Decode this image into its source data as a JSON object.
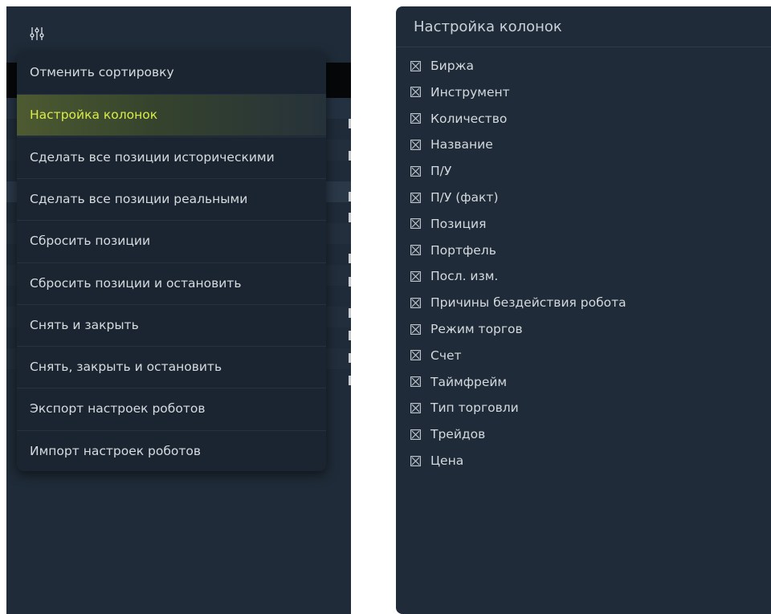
{
  "context_menu": {
    "items": [
      {
        "label": "Отменить сортировку"
      },
      {
        "label": "Настройка колонок",
        "active": true
      },
      {
        "label": "Сделать все позиции историческими"
      },
      {
        "label": "Сделать все позиции реальными"
      },
      {
        "label": "Сбросить позиции"
      },
      {
        "label": "Сбросить позиции и остановить"
      },
      {
        "label": "Снять и закрыть"
      },
      {
        "label": "Снять, закрыть и остановить"
      },
      {
        "label": "Экспорт настроек роботов"
      },
      {
        "label": "Импорт настроек роботов"
      }
    ]
  },
  "columns_panel": {
    "title": "Настройка колонок",
    "columns": [
      {
        "label": "Биржа",
        "checked": true
      },
      {
        "label": "Инструмент",
        "checked": true
      },
      {
        "label": "Количество",
        "checked": true
      },
      {
        "label": "Название",
        "checked": true
      },
      {
        "label": "П/У",
        "checked": true
      },
      {
        "label": "П/У (факт)",
        "checked": true
      },
      {
        "label": "Позиция",
        "checked": true
      },
      {
        "label": "Портфель",
        "checked": true
      },
      {
        "label": "Посл. изм.",
        "checked": true
      },
      {
        "label": "Причины бездействия робота",
        "checked": true
      },
      {
        "label": "Режим торгов",
        "checked": true
      },
      {
        "label": "Счет",
        "checked": true
      },
      {
        "label": "Таймфрейм",
        "checked": true
      },
      {
        "label": "Тип торговли",
        "checked": true
      },
      {
        "label": "Трейдов",
        "checked": true
      },
      {
        "label": "Цена",
        "checked": true
      }
    ]
  },
  "icons": {
    "toolbar": "sliders-icon",
    "checkbox": "checkbox-crossed-icon"
  },
  "colors": {
    "panel_bg": "#1f2b38",
    "menu_bg": "#1b2531",
    "active_text": "#d8ec4a",
    "active_bg": "#4d5a31",
    "text": "#d6dbe0"
  }
}
